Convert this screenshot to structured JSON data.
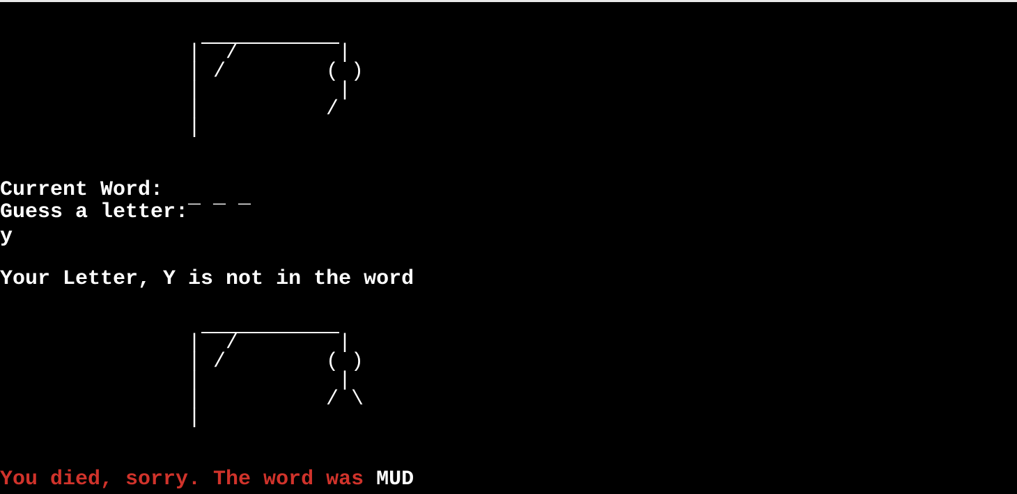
{
  "terminal": {
    "hangman_art_1": "|  /        |\n| /        ( )\n|           |\n|          /\n|",
    "current_word_label": "Current Word:",
    "current_word_value": "_ _ _",
    "guess_prompt": "Guess a letter:",
    "guess_input": "y",
    "feedback": "Your Letter, Y is not in the word",
    "hangman_art_2": "|  /        |\n| /        ( )\n|           |\n|          / \\\n|",
    "result_message": "You died, sorry. The word was",
    "result_word": "MUD"
  },
  "colors": {
    "background": "#000000",
    "text": "#ffffff",
    "error": "#d0332b"
  }
}
